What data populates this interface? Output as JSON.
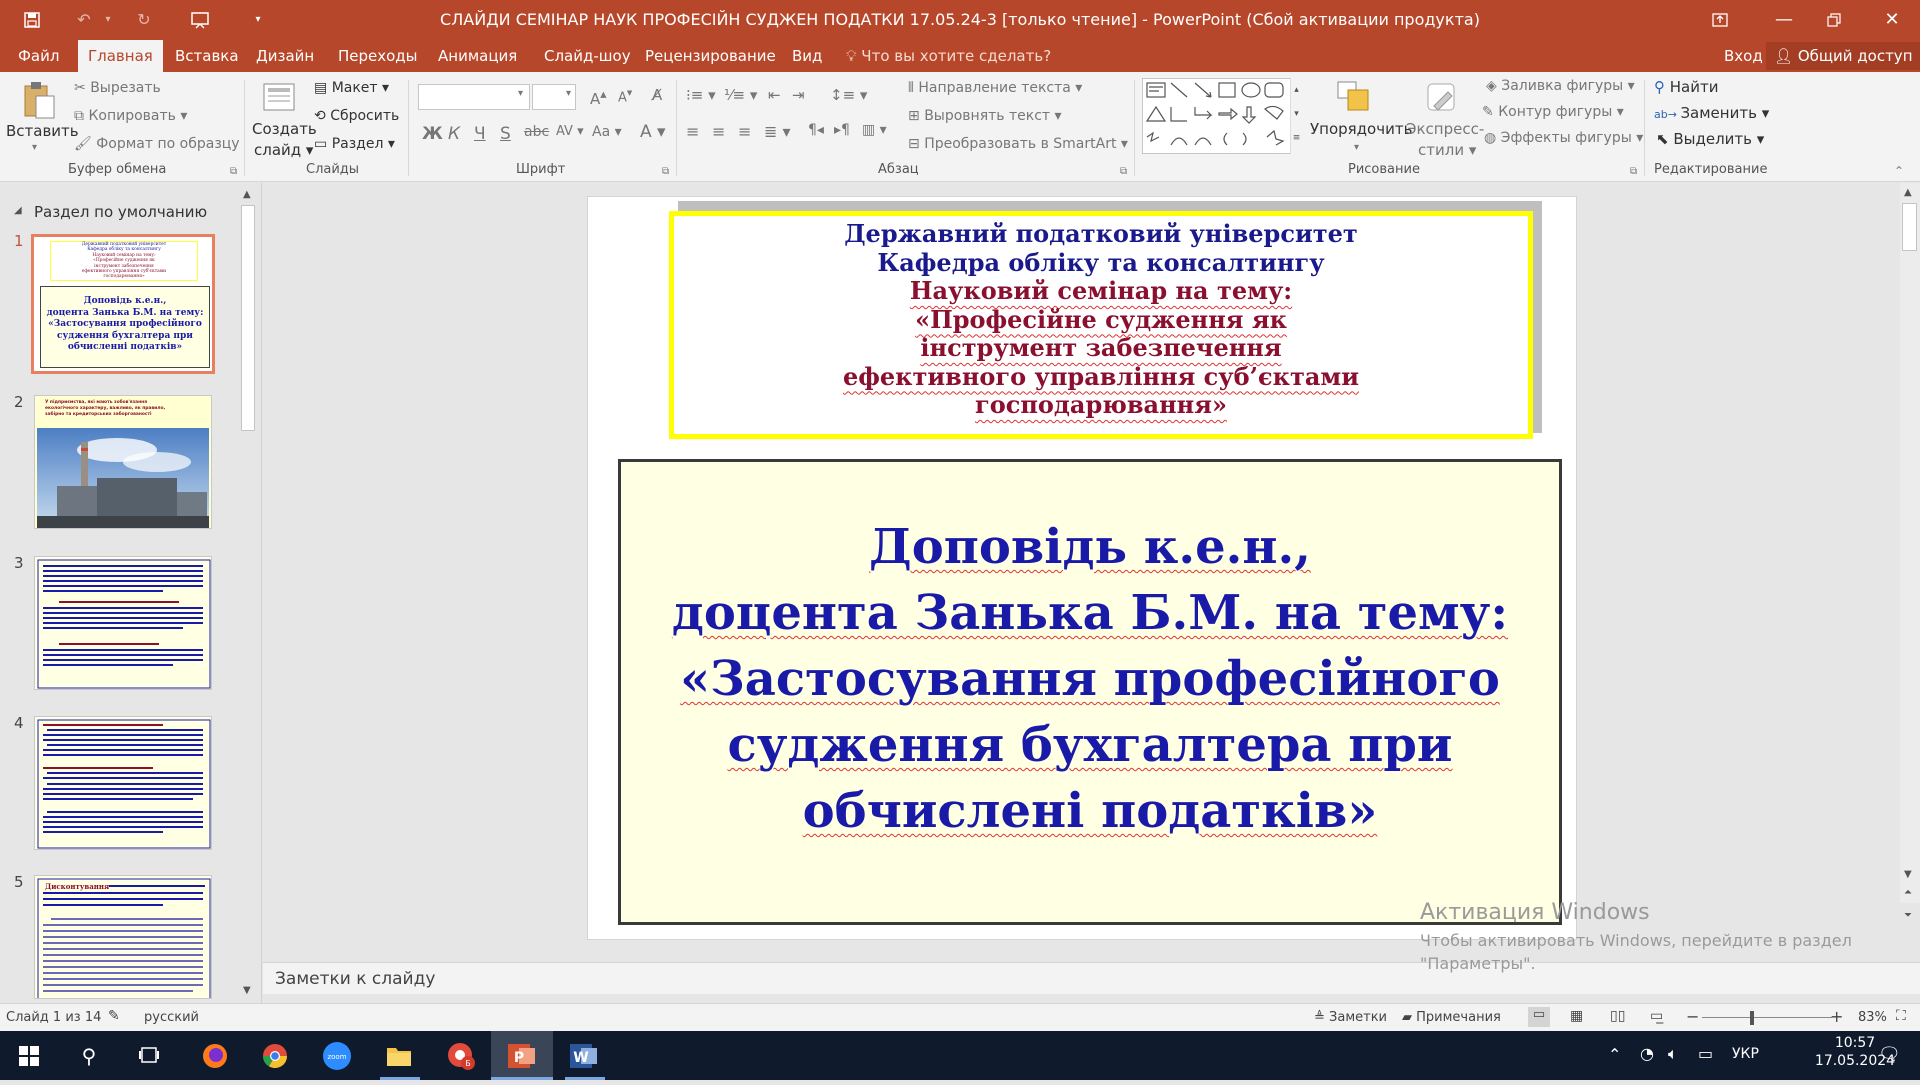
{
  "window": {
    "title": "СЛАЙДИ  СЕМІНАР НАУК ПРОФЕСІЙН СУДЖЕН ПОДАТКИ 17.05.24-3  [только чтение]  -  PowerPoint (Сбой активации продукта)",
    "accent_color": "#b7472a"
  },
  "tabs": [
    "Файл",
    "Главная",
    "Вставка",
    "Дизайн",
    "Переходы",
    "Анимация",
    "Слайд-шоу",
    "Рецензирование",
    "Вид"
  ],
  "tell_me": "Что вы хотите сделать?",
  "signin": "Вход",
  "share": "Общий доступ",
  "ribbon": {
    "clipboard": {
      "paste": "Вставить",
      "cut": "Вырезать",
      "copy": "Копировать",
      "format_painter": "Формат по образцу",
      "label": "Буфер обмена"
    },
    "slides": {
      "new_slide_1": "Создать",
      "new_slide_2": "слайд",
      "layout": "Макет",
      "reset": "Сбросить",
      "section": "Раздел",
      "label": "Слайды"
    },
    "font": {
      "bold": "Ж",
      "italic": "К",
      "underline": "Ч",
      "strike": "S",
      "label": "Шрифт"
    },
    "paragraph": {
      "direction": "Направление текста",
      "align_text": "Выровнять текст",
      "smartart": "Преобразовать в SmartArt",
      "label": "Абзац"
    },
    "drawing": {
      "arrange": "Упорядочить",
      "quick_1": "Экспресс-",
      "quick_2": "стили",
      "fill": "Заливка фигуры",
      "outline": "Контур фигуры",
      "effects": "Эффекты фигуры",
      "label": "Рисование"
    },
    "editing": {
      "find": "Найти",
      "replace": "Заменить",
      "select": "Выделить",
      "label": "Редактирование"
    }
  },
  "left_pane": {
    "section": "Раздел по умолчанию",
    "thumbs": [
      {
        "num": "1",
        "top_lines": [
          "Державний податковий університет",
          "Кафедра обліку та консалтингу",
          "Науковий семінар на тему:",
          "«Професійне судження як",
          "інструмент забезпечення",
          "ефективного управління суб'єктами",
          "господарювання»"
        ],
        "main_lines": [
          "Доповідь к.е.н.,",
          "доцента  Занька Б.М. на тему:",
          "«Застосування професійного",
          "судження бухгалтера при",
          "обчисленні податків»"
        ]
      },
      {
        "num": "2",
        "top_lines": [
          "У підприємства, які мають зобов'язання",
          "екологічного характеру, важливо, як правило,",
          "забірно та кредиторських заборгованості"
        ]
      },
      {
        "num": "3"
      },
      {
        "num": "4"
      },
      {
        "num": "5",
        "lead": "Дисконтування"
      }
    ]
  },
  "slide": {
    "header_lines": [
      {
        "text": "Державний податковий університет",
        "color": "blue",
        "squig": false
      },
      {
        "text": "Кафедра обліку та консалтингу",
        "color": "blue",
        "squig": false
      },
      {
        "text": "Науковий семінар на тему:",
        "color": "red",
        "squig": true
      },
      {
        "text": "«Професійне судження як",
        "color": "red",
        "squig": true
      },
      {
        "text": "інструмент забезпечення",
        "color": "red",
        "squig": true
      },
      {
        "text": "ефективного управління суб’єктами",
        "color": "red",
        "squig": true
      },
      {
        "text": "господарювання»",
        "color": "red",
        "squig": true
      }
    ],
    "main_lines": [
      "Доповідь к.е.н.,",
      "доцента  Занька Б.М. на тему:",
      "«Застосування професійного",
      "судження бухгалтера при",
      "обчислені податків»"
    ]
  },
  "notes_placeholder": "Заметки к слайду",
  "watermark": {
    "title": "Активация Windows",
    "line1": "Чтобы активировать Windows, перейдите в раздел",
    "line2": "\"Параметры\"."
  },
  "status": {
    "slide": "Слайд 1 из 14",
    "language": "русский",
    "notes": "Заметки",
    "comments": "Примечания",
    "zoom": "83%"
  },
  "taskbar": {
    "lang": "УКР",
    "time": "10:57",
    "date": "17.05.2024"
  }
}
